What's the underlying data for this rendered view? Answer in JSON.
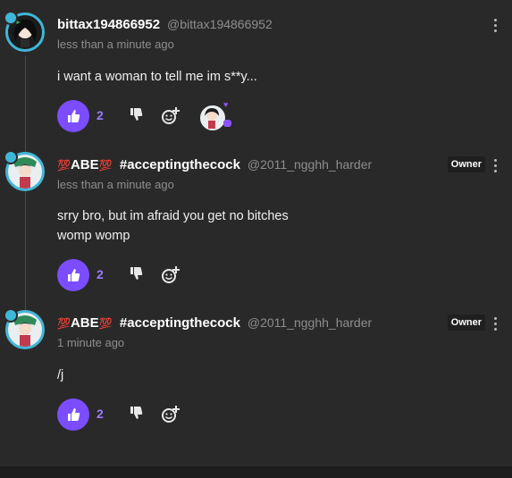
{
  "comments": [
    {
      "display_name": "bittax194866952",
      "handle": "@bittax194866952",
      "time": "less than a minute ago",
      "lines": [
        "i want a woman to tell me im s**y..."
      ],
      "likes": "2",
      "owner_badge": ""
    },
    {
      "display_name_prefix": "💯",
      "display_name_main": "ABE",
      "display_name_suffix": "💯",
      "display_name_tag": "#acceptingthecock",
      "handle": "@2011_ngghh_harder",
      "time": "less than a minute ago",
      "lines": [
        "srry bro, but im afraid you get no bitches",
        "womp womp"
      ],
      "likes": "2",
      "owner_badge": "Owner"
    },
    {
      "display_name_prefix": "💯",
      "display_name_main": "ABE",
      "display_name_suffix": "💯",
      "display_name_tag": "#acceptingthecock",
      "handle": "@2011_ngghh_harder",
      "time": "1 minute ago",
      "lines": [
        "/j"
      ],
      "likes": "2",
      "owner_badge": "Owner"
    }
  ],
  "colors": {
    "background": "#2a2929",
    "accent": "#7b4dff",
    "like_count": "#9e7bff",
    "avatar_ring": "#3fb7d8"
  },
  "icons": [
    "thumbs-up-icon",
    "thumbs-down-icon",
    "add-emoji-icon",
    "kebab-menu-icon",
    "heart-icon"
  ]
}
